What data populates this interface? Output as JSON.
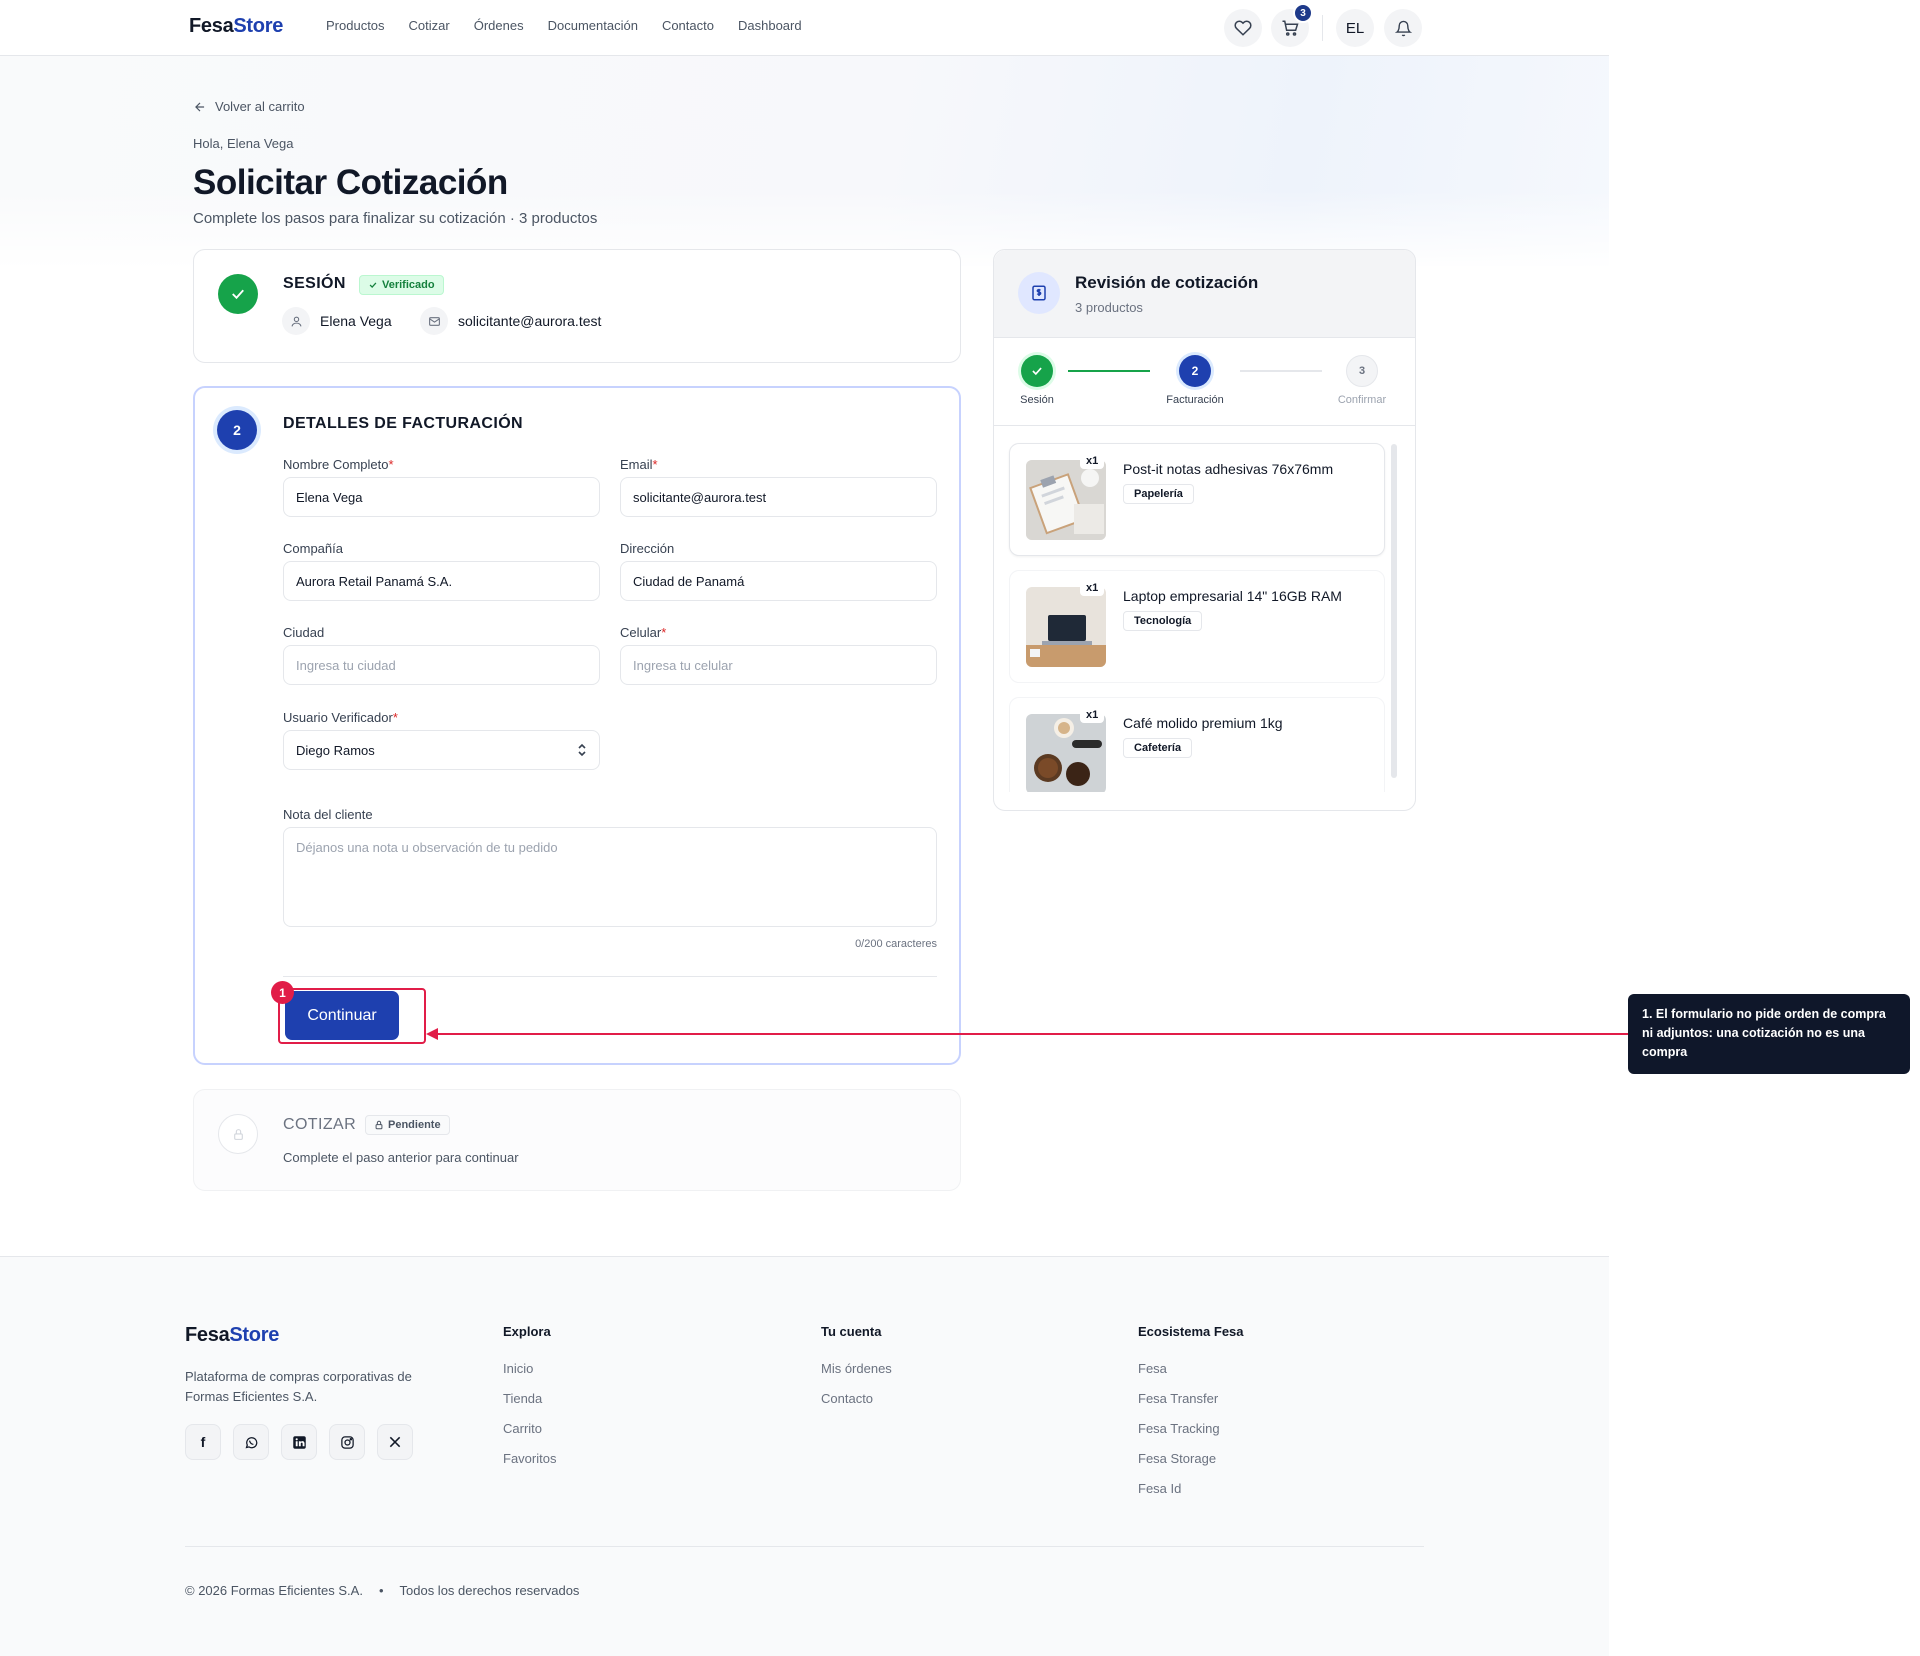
{
  "header": {
    "logo_a": "Fesa",
    "logo_b": "Store",
    "nav": [
      "Productos",
      "Cotizar",
      "Órdenes",
      "Documentación",
      "Contacto",
      "Dashboard"
    ],
    "cart_count": "3",
    "avatar": "EL"
  },
  "page": {
    "back_label": "Volver al carrito",
    "greeting": "Hola, Elena Vega",
    "title": "Solicitar Cotización",
    "subtitle": "Complete los pasos para finalizar su cotización",
    "subtitle_count": " · 3 productos"
  },
  "session": {
    "title": "SESIÓN",
    "badge": "Verificado",
    "user": "Elena Vega",
    "email": "solicitante@aurora.test"
  },
  "billing": {
    "step": "2",
    "title": "DETALLES DE FACTURACIÓN",
    "fields": {
      "name": {
        "label": "Nombre Completo",
        "value": "Elena Vega"
      },
      "email": {
        "label": "Email",
        "value": "solicitante@aurora.test"
      },
      "company": {
        "label": "Compañía",
        "value": "Aurora Retail Panamá S.A."
      },
      "address": {
        "label": "Dirección",
        "value": "Ciudad de Panamá"
      },
      "city": {
        "label": "Ciudad",
        "placeholder": "Ingresa tu ciudad"
      },
      "phone": {
        "label": "Celular",
        "placeholder": "Ingresa tu celular"
      },
      "verifier": {
        "label": "Usuario Verificador",
        "value": "Diego Ramos"
      },
      "note": {
        "label": "Nota del cliente",
        "placeholder": "Déjanos una nota u observación de tu pedido",
        "counter": "0/200 caracteres"
      }
    },
    "required_mark": "*",
    "continue": "Continuar"
  },
  "quote": {
    "title": "COTIZAR",
    "badge": "Pendiente",
    "desc": "Complete el paso anterior para continuar"
  },
  "review": {
    "title": "Revisión de cotización",
    "subtitle": "3 productos",
    "steps": [
      {
        "num": "",
        "label": "Sesión"
      },
      {
        "num": "2",
        "label": "Facturación"
      },
      {
        "num": "3",
        "label": "Confirmar"
      }
    ],
    "products": [
      {
        "qty": "x1",
        "name": "Post-it notas adhesivas 76x76mm",
        "tag": "Papelería"
      },
      {
        "qty": "x1",
        "name": "Laptop empresarial 14\" 16GB RAM",
        "tag": "Tecnología"
      },
      {
        "qty": "x1",
        "name": "Café molido premium 1kg",
        "tag": "Cafetería"
      }
    ]
  },
  "footer": {
    "logo_a": "Fesa",
    "logo_b": "Store",
    "desc_1": "Plataforma de compras corporativas de",
    "desc_2": "Formas Eficientes S.A.",
    "col1": {
      "title": "Explora",
      "links": [
        "Inicio",
        "Tienda",
        "Carrito",
        "Favoritos"
      ]
    },
    "col2": {
      "title": "Tu cuenta",
      "links": [
        "Mis órdenes",
        "Contacto"
      ]
    },
    "col3": {
      "title": "Ecosistema Fesa",
      "links": [
        "Fesa",
        "Fesa Transfer",
        "Fesa Tracking",
        "Fesa Storage",
        "Fesa Id"
      ]
    },
    "copyright": "© 2026 Formas Eficientes S.A.",
    "dot": "•",
    "rights": "Todos los derechos reservados"
  },
  "annotation": {
    "marker": "1",
    "text": "1. El formulario no pide orden de compra ni adjuntos: una cotización no es una compra",
    "color": "#e11d48"
  },
  "colors": {
    "brand": "#1e40af",
    "success": "#16a34a",
    "dark_navy": "#0f172a"
  }
}
